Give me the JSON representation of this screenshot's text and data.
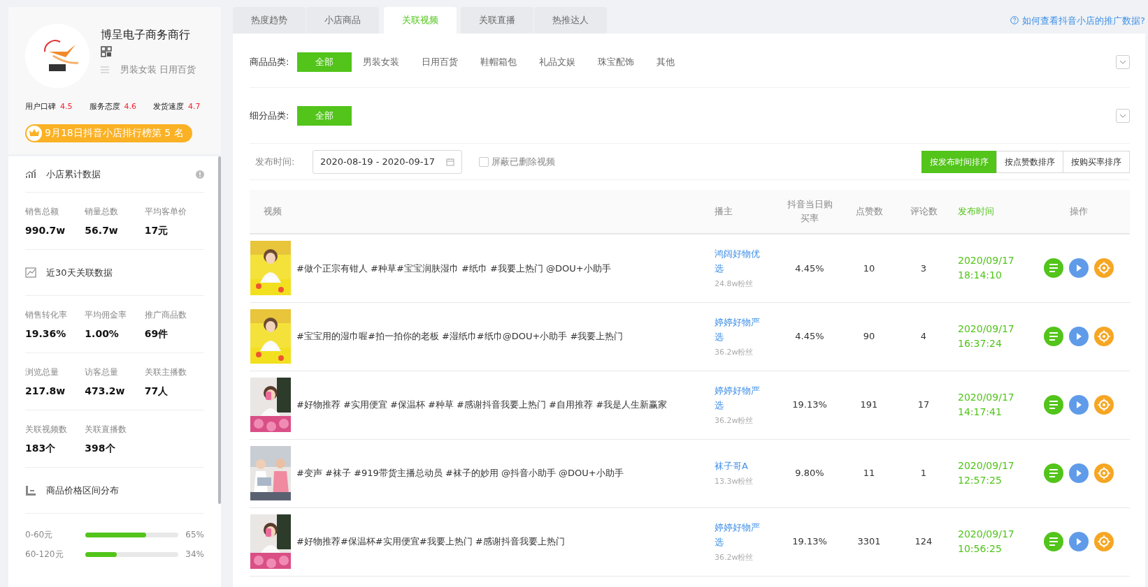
{
  "shop": {
    "name": "博呈电子商务商行",
    "categories": "男装女装 日用百货",
    "ratings": [
      {
        "label": "用户口碑",
        "value": "4.5"
      },
      {
        "label": "服务态度",
        "value": "4.6"
      },
      {
        "label": "发货速度",
        "value": "4.7"
      }
    ],
    "rank_badge": "9月18日抖音小店排行榜第 5 名"
  },
  "sections": [
    {
      "kind": "stats",
      "title": "小店累计数据",
      "has_info": true,
      "groups": [
        [
          {
            "label": "销售总额",
            "value": "990.7w"
          },
          {
            "label": "销量总数",
            "value": "56.7w"
          },
          {
            "label": "平均客单价",
            "value": "17元"
          }
        ]
      ]
    },
    {
      "kind": "stats",
      "title": "近30天关联数据",
      "has_info": false,
      "groups": [
        [
          {
            "label": "销售转化率",
            "value": "19.36%"
          },
          {
            "label": "平均佣金率",
            "value": "1.00%"
          },
          {
            "label": "推广商品数",
            "value": "69件"
          }
        ],
        [
          {
            "label": "浏览总量",
            "value": "217.8w"
          },
          {
            "label": "访客总量",
            "value": "473.2w"
          },
          {
            "label": "关联主播数",
            "value": "77人"
          }
        ],
        [
          {
            "label": "关联视频数",
            "value": "183个"
          },
          {
            "label": "关联直播数",
            "value": "398个"
          }
        ]
      ]
    },
    {
      "kind": "distribution",
      "title": "商品价格区间分布",
      "has_info": false,
      "bars": [
        {
          "label": "0-60元",
          "level": 0.65,
          "reading": "65%"
        },
        {
          "label": "60-120元",
          "level": 0.34,
          "reading": "34%"
        }
      ]
    }
  ],
  "tabs": [
    {
      "label": "热度趋势",
      "selected": false
    },
    {
      "label": "小店商品",
      "selected": false
    },
    {
      "label": "关联视频",
      "selected": true
    },
    {
      "label": "关联直播",
      "selected": false
    },
    {
      "label": "热推达人",
      "selected": false
    }
  ],
  "help_link": "如何查看抖音小店的推广数据?",
  "filters": [
    {
      "label": "商品品类:",
      "options": [
        {
          "label": "全部",
          "selected": true
        },
        {
          "label": "男装女装",
          "selected": false
        },
        {
          "label": "日用百货",
          "selected": false
        },
        {
          "label": "鞋帽箱包",
          "selected": false
        },
        {
          "label": "礼品文娱",
          "selected": false
        },
        {
          "label": "珠宝配饰",
          "selected": false
        },
        {
          "label": "其他",
          "selected": false
        }
      ]
    },
    {
      "label": "细分品类:",
      "options": [
        {
          "label": "全部",
          "selected": true
        }
      ]
    }
  ],
  "date_filter": {
    "label": "发布时间:",
    "value": "2020-08-19 - 2020-09-17"
  },
  "hide_deleted": {
    "label": "屏蔽已删除视频",
    "checked": false
  },
  "sort_buttons": [
    {
      "label": "按发布时间排序",
      "selected": true
    },
    {
      "label": "按点赞数排序",
      "selected": false
    },
    {
      "label": "按购买率排序",
      "selected": false
    }
  ],
  "table": {
    "columns": [
      {
        "label": "视频",
        "sorted": false
      },
      {
        "label": "播主",
        "sorted": false
      },
      {
        "label": "抖音当日购买率",
        "sorted": false
      },
      {
        "label": "点赞数",
        "sorted": false
      },
      {
        "label": "评论数",
        "sorted": false
      },
      {
        "label": "发布时间",
        "sorted": true
      },
      {
        "label": "操作",
        "sorted": false
      }
    ],
    "rows": [
      {
        "title": "#做个正宗有钳人 #种草#宝宝润肤湿巾 #纸巾 #我要上热门 @DOU+小助手",
        "streamer": "鸿阔好物优选",
        "fans": "24.8w粉丝",
        "rate": "4.45%",
        "likes": "10",
        "comments": "3",
        "date": "2020/09/17",
        "time": "18:14:10"
      },
      {
        "title": "#宝宝用的湿巾喔#拍一拍你的老板 #湿纸巾#纸巾@DOU+小助手 #我要上热门",
        "streamer": "婷婷好物严选",
        "fans": "36.2w粉丝",
        "rate": "4.45%",
        "likes": "90",
        "comments": "4",
        "date": "2020/09/17",
        "time": "16:37:24"
      },
      {
        "title": "#好物推荐 #实用便宜 #保温杯 #种草 #感谢抖音我要上热门 #自用推荐 #我是人生新赢家",
        "streamer": "婷婷好物严选",
        "fans": "36.2w粉丝",
        "rate": "19.13%",
        "likes": "191",
        "comments": "17",
        "date": "2020/09/17",
        "time": "14:17:41"
      },
      {
        "title": "#变声 #袜子 #919带货主播总动员 #袜子的妙用 @抖音小助手 @DOU+小助手",
        "streamer": "袜子哥A",
        "fans": "13.3w粉丝",
        "rate": "9.80%",
        "likes": "11",
        "comments": "1",
        "date": "2020/09/17",
        "time": "12:57:25"
      },
      {
        "title": "#好物推荐#保温杯#实用便宜#我要上热门 #感谢抖音我要上热门",
        "streamer": "婷婷好物严选",
        "fans": "36.2w粉丝",
        "rate": "19.13%",
        "likes": "3301",
        "comments": "124",
        "date": "2020/09/17",
        "time": "10:56:25"
      }
    ]
  }
}
